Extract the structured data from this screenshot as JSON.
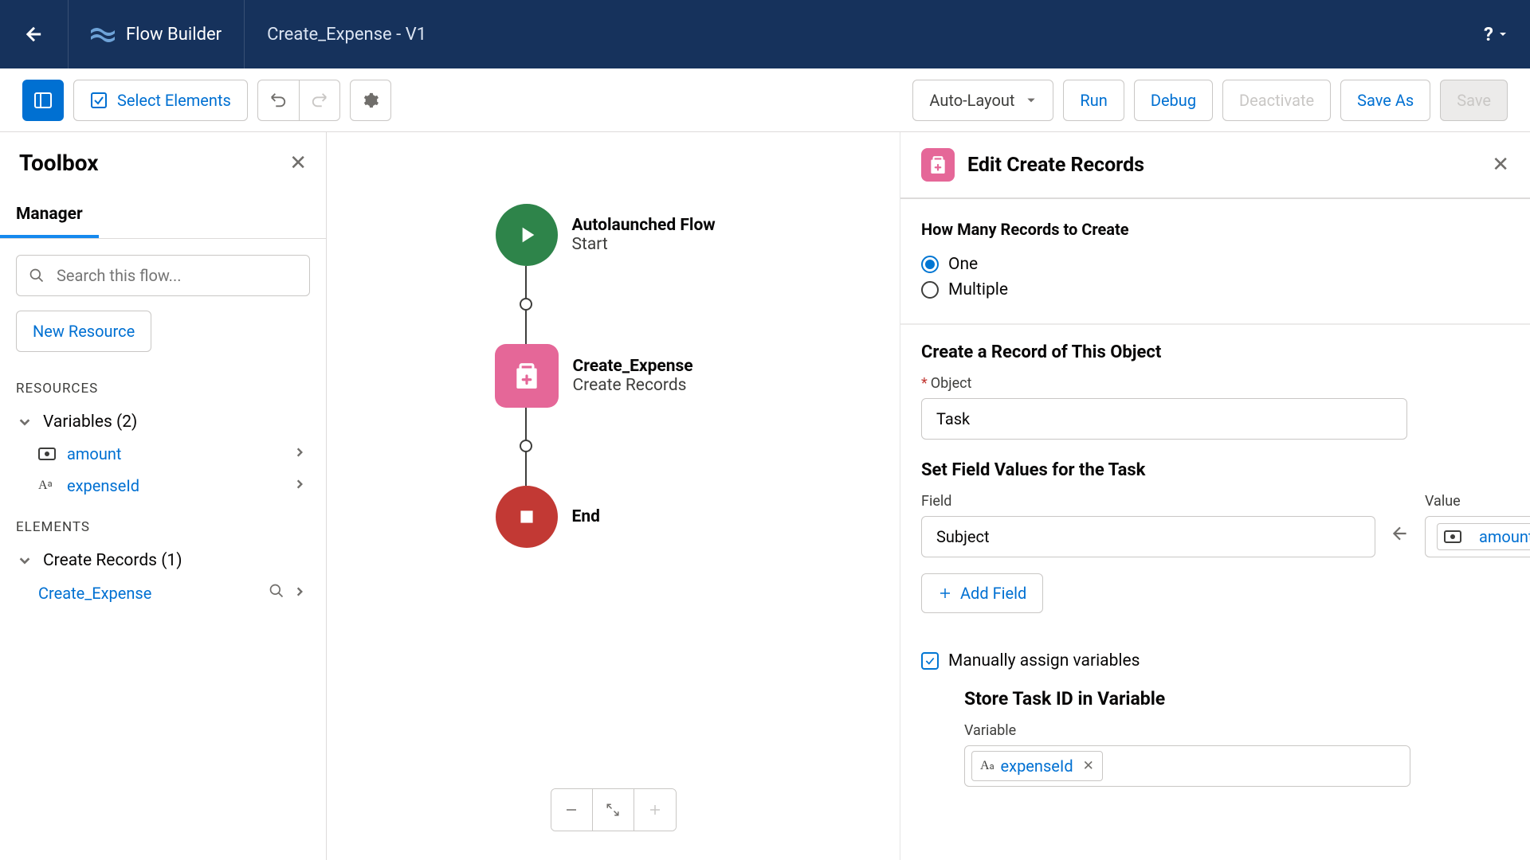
{
  "header": {
    "app_title": "Flow Builder",
    "tab_title": "Create_Expense - V1",
    "help": "?"
  },
  "toolbar": {
    "select_elements": "Select Elements",
    "layout_mode": "Auto-Layout",
    "run": "Run",
    "debug": "Debug",
    "deactivate": "Deactivate",
    "save_as": "Save As",
    "save": "Save"
  },
  "toolbox": {
    "title": "Toolbox",
    "tab_manager": "Manager",
    "search_placeholder": "Search this flow...",
    "new_resource": "New Resource",
    "section_resources": "RESOURCES",
    "variables_group": "Variables (2)",
    "var_amount": "amount",
    "var_expense_id": "expenseId",
    "section_elements": "ELEMENTS",
    "create_records_group": "Create Records (1)",
    "element_create_expense": "Create_Expense"
  },
  "canvas": {
    "start_title": "Autolaunched Flow",
    "start_sub": "Start",
    "node_title": "Create_Expense",
    "node_sub": "Create Records",
    "end_title": "End"
  },
  "panel": {
    "title": "Edit Create Records",
    "how_many_label": "How Many Records to Create",
    "option_one": "One",
    "option_multiple": "Multiple",
    "create_record_title": "Create a Record of This Object",
    "object_label": "Object",
    "object_value": "Task",
    "set_values_title": "Set Field Values for the Task",
    "field_label": "Field",
    "field_value": "Subject",
    "value_label": "Value",
    "value_value": "amount",
    "add_field": "Add Field",
    "manually_assign": "Manually assign variables",
    "store_title": "Store Task ID in Variable",
    "variable_label": "Variable",
    "variable_value": "expenseId"
  }
}
